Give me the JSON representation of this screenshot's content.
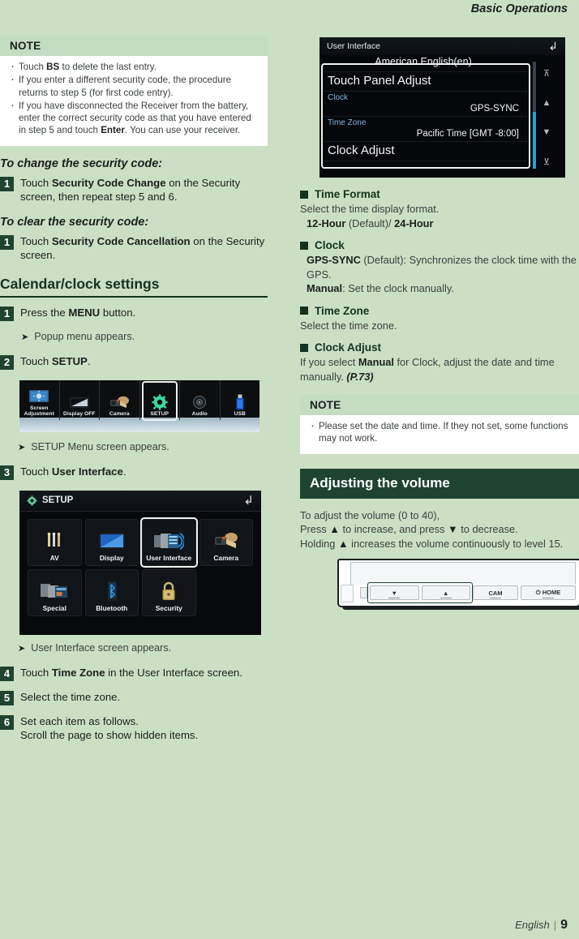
{
  "header": {
    "title": "Basic Operations"
  },
  "footer": {
    "language": "English",
    "separator": "|",
    "page": "9"
  },
  "left": {
    "note1": {
      "label": "NOTE",
      "items_html": [
        "Touch <b>BS</b> to delete the last entry.",
        "If you enter a different security code, the procedure returns to step 5 (for first code entry).",
        "If you have disconnected the Receiver from the battery, enter the correct security code as that you have entered in step 5 and touch <b>Enter</b>. You can use your receiver."
      ]
    },
    "heading_change": "To change the security code:",
    "step_change": {
      "num": "1",
      "html": "Touch <b>Security Code Change</b> on the Security screen, then repeat step 5 and 6."
    },
    "heading_clear": "To clear the security code:",
    "step_clear": {
      "num": "1",
      "html": "Touch <b>Security Code Cancellation</b> on the Security screen."
    },
    "section_title": "Calendar/clock settings",
    "step1": {
      "num": "1",
      "html": "Press the <b>MENU</b> button."
    },
    "step1_result": "Popup menu appears.",
    "step2": {
      "num": "2",
      "html": "Touch <b>SETUP</b>."
    },
    "popup_menu": {
      "items": [
        {
          "label": "Screen Adjustment",
          "icon": "screen-adjustment-icon",
          "selected": false
        },
        {
          "label": "Display OFF",
          "icon": "display-off-icon",
          "selected": false
        },
        {
          "label": "Camera",
          "icon": "camera-icon",
          "selected": false
        },
        {
          "label": "SETUP",
          "icon": "gear-icon",
          "selected": true
        },
        {
          "label": "Audio",
          "icon": "audio-icon",
          "selected": false
        },
        {
          "label": "USB",
          "icon": "usb-icon",
          "selected": false
        }
      ]
    },
    "step2_result": "SETUP Menu screen appears.",
    "step3": {
      "num": "3",
      "html": "Touch <b>User Interface</b>."
    },
    "setup_screen": {
      "title": "SETUP",
      "back_icon": "back-arrow-icon",
      "gear_icon": "gear-icon",
      "tiles": [
        {
          "label": "AV",
          "icon": "av-icon",
          "selected": false
        },
        {
          "label": "Display",
          "icon": "display-icon",
          "selected": false
        },
        {
          "label": "User Interface",
          "icon": "user-interface-icon",
          "selected": true
        },
        {
          "label": "Camera",
          "icon": "camera-icon",
          "selected": false
        },
        {
          "label": "Special",
          "icon": "special-icon",
          "selected": false
        },
        {
          "label": "Bluetooth",
          "icon": "bluetooth-icon",
          "selected": false
        },
        {
          "label": "Security",
          "icon": "lock-icon",
          "selected": false
        }
      ]
    },
    "step3_result": "User Interface screen appears.",
    "step4": {
      "num": "4",
      "html": "Touch <b>Time Zone</b> in the User Interface screen."
    },
    "step5": {
      "num": "5",
      "html": "Select the time zone."
    },
    "step6": {
      "num": "6",
      "html": "Set each item as follows."
    },
    "step6_sub": "Scroll the page to show hidden items."
  },
  "right": {
    "ui_screen": {
      "title": "User Interface",
      "back_icon": "back-arrow-icon",
      "rows": [
        {
          "key": "",
          "value": "American English(en)",
          "type": "value-only"
        },
        {
          "key": "",
          "value": "Touch Panel Adjust",
          "type": "big"
        },
        {
          "key": "Clock",
          "value": "GPS-SYNC",
          "type": "pair"
        },
        {
          "key": "Time Zone",
          "value": "Pacific Time [GMT -8:00]",
          "type": "pair"
        },
        {
          "key": "",
          "value": "Clock Adjust",
          "type": "big"
        }
      ],
      "controls": [
        {
          "icon": "scroll-top-icon"
        },
        {
          "icon": "scroll-up-icon"
        },
        {
          "icon": "scroll-down-icon"
        },
        {
          "icon": "scroll-bottom-icon"
        }
      ]
    },
    "time_format": {
      "title": "Time Format",
      "desc": "Select the time display format.",
      "options_html": "<b>12-Hour</b> (Default)/ <b>24-Hour</b>"
    },
    "clock": {
      "title": "Clock",
      "line1_html": "<b>GPS-SYNC</b> (Default): Synchronizes the clock time with the GPS.",
      "line2_html": "<b>Manual</b>: Set the clock manually."
    },
    "time_zone": {
      "title": "Time Zone",
      "desc": "Select the time zone."
    },
    "clock_adjust": {
      "title": "Clock Adjust",
      "desc_html": "If you select <b>Manual</b> for Clock, adjust the date and time manually. <span class=\"it\">(P.73)</span>"
    },
    "note2": {
      "label": "NOTE",
      "items_html": [
        "Please set the date and time. If they not set, some functions may not work."
      ]
    },
    "volume": {
      "band_title": "Adjusting the volume",
      "line1": "To adjust the volume (0 to 40),",
      "line2_html": "Press <b>▲</b> to increase, and press <b>▼</b> to decrease.",
      "line3_html": "Holding <b>▲</b> increases the volume continuously to level 15."
    },
    "faceplate": {
      "buttons": [
        {
          "label": "▼",
          "name": "volume-down-button"
        },
        {
          "label": "▲",
          "name": "volume-up-button"
        },
        {
          "label": "CAM",
          "name": "cam-button"
        },
        {
          "label": "⏻ HOME",
          "name": "home-button"
        }
      ]
    }
  },
  "colors": {
    "page_bg": "#cbdfc4",
    "dark_green": "#1e4430",
    "heading_green": "#14331f",
    "note_header": "#c3dcc2",
    "note_bg": "#ffffff",
    "screen_key": "#7fb8e0",
    "scrollbar": "#2a9fd8"
  }
}
